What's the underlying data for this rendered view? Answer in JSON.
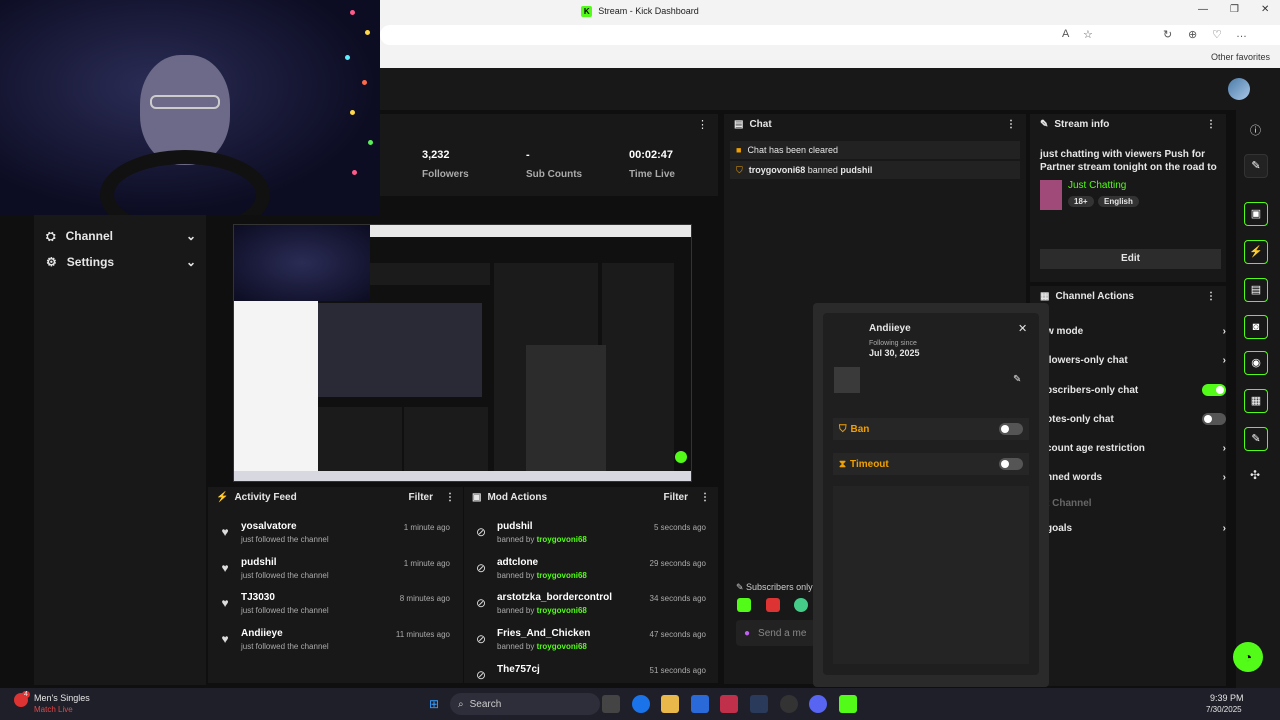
{
  "window": {
    "title": "Stream - Kick Dashboard",
    "favicon": "K",
    "minimize": "—",
    "maximize": "❐",
    "close": "✕"
  },
  "browser": {
    "other_favorites": "Other favorites",
    "toolbar_icons": [
      "A",
      "☆",
      "↻",
      "⊕",
      "♡",
      "…"
    ]
  },
  "sidebar": {
    "items": [
      {
        "label": "Channel",
        "icon": "channel-icon"
      },
      {
        "label": "Settings",
        "icon": "gear-icon"
      }
    ]
  },
  "stats": [
    {
      "value": "3,232",
      "label": "Followers"
    },
    {
      "value": "-",
      "label": "Sub Counts"
    },
    {
      "value": "00:02:47",
      "label": "Time Live"
    }
  ],
  "activity_feed": {
    "title": "Activity Feed",
    "filter": "Filter",
    "items": [
      {
        "name": "yosalvatore",
        "sub": "just followed the channel",
        "time": "1 minute ago"
      },
      {
        "name": "pudshil",
        "sub": "just followed the channel",
        "time": "1 minute ago"
      },
      {
        "name": "TJ3030",
        "sub": "just followed the channel",
        "time": "8 minutes ago"
      },
      {
        "name": "Andiieye",
        "sub": "just followed the channel",
        "time": "11 minutes ago"
      }
    ]
  },
  "mod_actions": {
    "title": "Mod Actions",
    "filter": "Filter",
    "banned_by": "banned by",
    "moderator": "troygovoni68",
    "items": [
      {
        "name": "pudshil",
        "time": "5 seconds ago"
      },
      {
        "name": "adtclone",
        "time": "29 seconds ago"
      },
      {
        "name": "arstotzka_bordercontrol",
        "time": "34 seconds ago"
      },
      {
        "name": "Fries_And_Chicken",
        "time": "47 seconds ago"
      },
      {
        "name": "The757cj",
        "time": "51 seconds ago"
      }
    ]
  },
  "chat": {
    "title": "Chat",
    "cleared": "Chat has been cleared",
    "ban_user": "troygovoni68",
    "ban_text": "banned",
    "ban_target": "pudshil",
    "subscribers_only": "Subscribers only",
    "input_placeholder": "Send a me"
  },
  "stream_info": {
    "title": "Stream info",
    "stream_title": "just chatting with viewers Push for Partner stream tonight on the road to ...",
    "category": "Just Chatting",
    "tags": [
      "18+",
      "English"
    ],
    "edit": "Edit"
  },
  "channel_actions": {
    "title": "Channel Actions",
    "rows": [
      {
        "label": "w mode",
        "type": "chevron"
      },
      {
        "label": "llowers-only chat",
        "type": "chevron"
      },
      {
        "label": "bscribers-only chat",
        "type": "toggle",
        "on": true
      },
      {
        "label": "otes-only chat",
        "type": "toggle",
        "on": false
      },
      {
        "label": "count age restriction",
        "type": "chevron"
      },
      {
        "label": "nned words",
        "type": "chevron"
      },
      {
        "label": "t Channel",
        "type": "none"
      },
      {
        "label": "goals",
        "type": "chevron"
      }
    ]
  },
  "user_popup": {
    "username": "Andiieye",
    "following_since_label": "Following since",
    "following_since": "Jul 30, 2025",
    "ban": "Ban",
    "timeout": "Timeout"
  },
  "taskbar": {
    "widget_title": "Men's Singles",
    "widget_sub": "Match Live",
    "badge": "4",
    "search": "Search",
    "time": "9:39 PM",
    "date": "7/30/2025"
  },
  "colors": {
    "accent": "#53fc18",
    "warning": "#f0a000"
  }
}
